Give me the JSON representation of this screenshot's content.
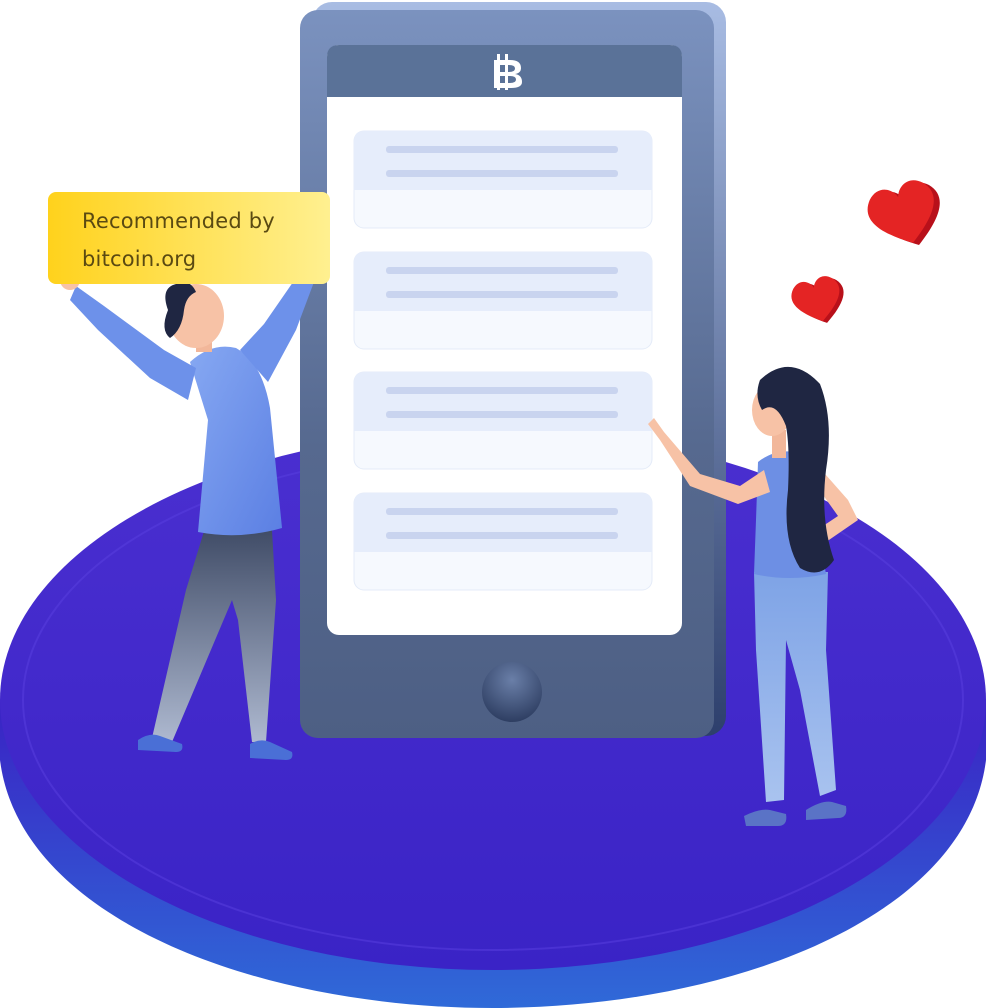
{
  "sign": {
    "line1": "Recommended by",
    "line2": "bitcoin.org"
  },
  "phone": {
    "header_icon": "bitcoin-icon",
    "list_item_count": 4,
    "home_button_icon": "home-button"
  },
  "decorations": {
    "hearts": [
      "heart-icon",
      "heart-icon"
    ]
  },
  "colors": {
    "platform": "#3a22c8",
    "phone_body": "#5c7399",
    "screen": "#ffffff",
    "sign": "#ffd84a",
    "heart": "#e02020",
    "shirt": "#6f93ec"
  }
}
